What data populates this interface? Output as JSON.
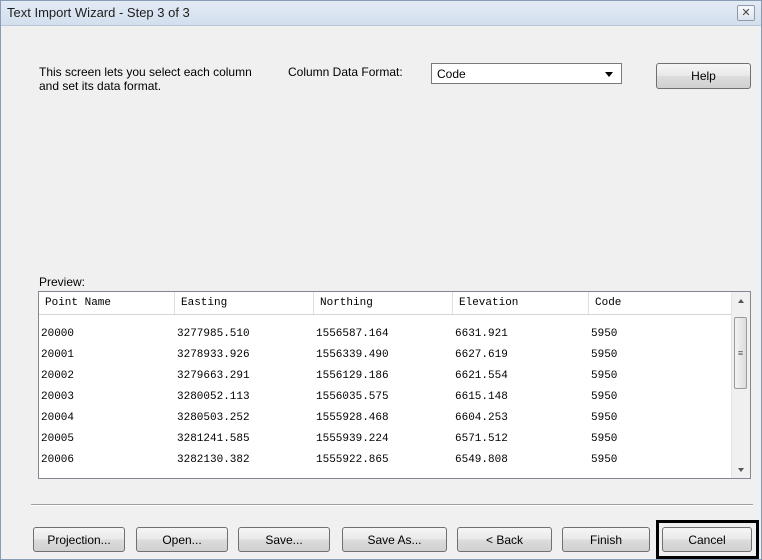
{
  "window": {
    "title": "Text Import Wizard - Step 3 of 3",
    "close_icon": "close-icon"
  },
  "description": "This screen lets you select each column and set its data format.",
  "column_format": {
    "label": "Column Data Format:",
    "value": "Code"
  },
  "help_label": "Help",
  "preview": {
    "label": "Preview:",
    "columns": [
      "Point Name",
      "Easting",
      "Northing",
      "Elevation",
      "Code"
    ],
    "rows": [
      [
        "20000",
        "3277985.510",
        "1556587.164",
        "6631.921",
        "5950"
      ],
      [
        "20001",
        "3278933.926",
        "1556339.490",
        "6627.619",
        "5950"
      ],
      [
        "20002",
        "3279663.291",
        "1556129.186",
        "6621.554",
        "5950"
      ],
      [
        "20003",
        "3280052.113",
        "1556035.575",
        "6615.148",
        "5950"
      ],
      [
        "20004",
        "3280503.252",
        "1555928.468",
        "6604.253",
        "5950"
      ],
      [
        "20005",
        "3281241.585",
        "1555939.224",
        "6571.512",
        "5950"
      ],
      [
        "20006",
        "3282130.382",
        "1555922.865",
        "6549.808",
        "5950"
      ]
    ]
  },
  "buttons": {
    "projection": "Projection...",
    "open": "Open...",
    "save": "Save...",
    "save_as": "Save As...",
    "back": "< Back",
    "finish": "Finish",
    "cancel": "Cancel"
  }
}
